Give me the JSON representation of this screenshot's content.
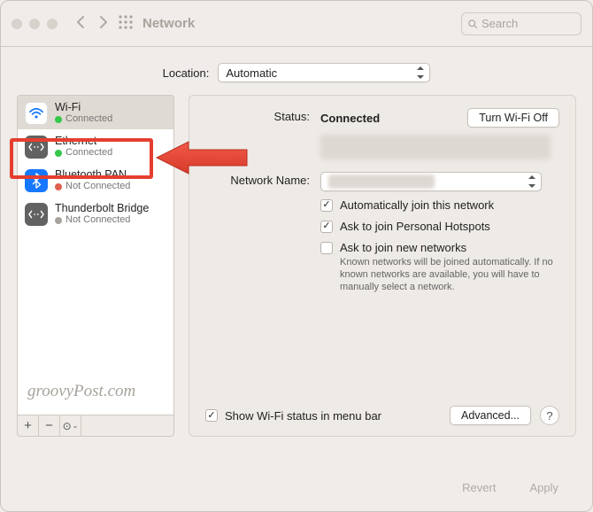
{
  "window": {
    "title": "Network",
    "search_placeholder": "Search"
  },
  "location": {
    "label": "Location:",
    "value": "Automatic"
  },
  "sidebar": {
    "items": [
      {
        "name": "Wi-Fi",
        "status": "Connected",
        "dot": "green",
        "icon": "wifi",
        "selected": true
      },
      {
        "name": "Ethernet",
        "status": "Connected",
        "dot": "green",
        "icon": "eth",
        "highlighted": true
      },
      {
        "name": "Bluetooth PAN",
        "status": "Not Connected",
        "dot": "red",
        "icon": "bt"
      },
      {
        "name": "Thunderbolt Bridge",
        "status": "Not Connected",
        "dot": "grey",
        "icon": "tb"
      }
    ]
  },
  "detail": {
    "status_label": "Status:",
    "status_value": "Connected",
    "wifi_off_button": "Turn Wi-Fi Off",
    "network_name_label": "Network Name:",
    "check_auto_join": "Automatically join this network",
    "check_personal_hotspot": "Ask to join Personal Hotspots",
    "check_ask_new": "Ask to join new networks",
    "ask_new_hint": "Known networks will be joined automatically. If no known networks are available, you will have to manually select a network.",
    "show_menu_bar": "Show Wi-Fi status in menu bar",
    "advanced_button": "Advanced...",
    "help_label": "?"
  },
  "footer": {
    "revert": "Revert",
    "apply": "Apply"
  },
  "watermark": "groovyPost.com",
  "annotation": {
    "highlight_color": "#e53e2f"
  }
}
